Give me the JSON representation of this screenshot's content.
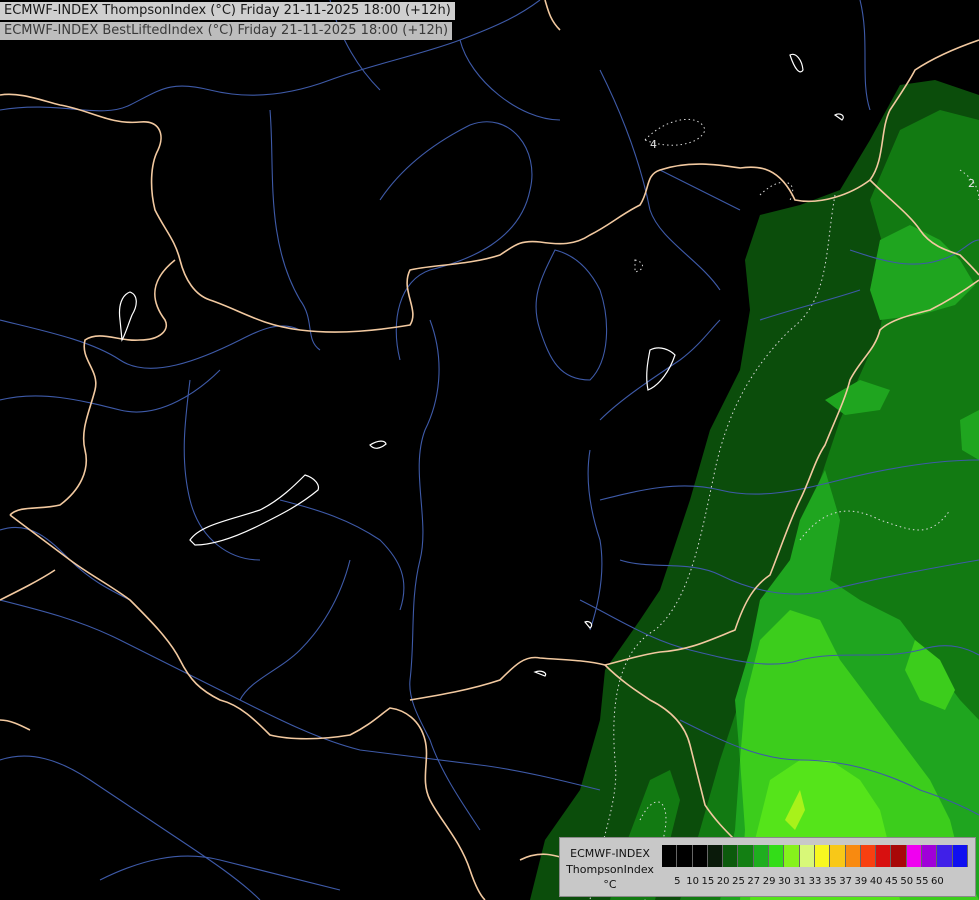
{
  "header": {
    "line1": "ECMWF-INDEX ThompsonIndex (°C) Friday 21-11-2025 18:00 (+12h)",
    "line2": "ECMWF-INDEX BestLiftedIndex (°C) Friday 21-11-2025 18:00 (+12h)"
  },
  "legend": {
    "line1": "ECMWF-INDEX",
    "line2": "ThompsonIndex",
    "line3": "°C",
    "ticks": [
      "5",
      "10",
      "15",
      "20",
      "25",
      "27",
      "29",
      "30",
      "31",
      "33",
      "35",
      "37",
      "39",
      "40",
      "45",
      "50",
      "55",
      "60"
    ],
    "colors": [
      "#000000",
      "#000000",
      "#000000",
      "#0a1a0a",
      "#0c5a0c",
      "#137f13",
      "#1fae1f",
      "#33dd18",
      "#86f21c",
      "#d8f878",
      "#f8f820",
      "#f8c818",
      "#f88a10",
      "#f84010",
      "#d81010",
      "#a80808",
      "#f000f0",
      "#a000d8",
      "#4020e8",
      "#1010f0"
    ]
  },
  "contour_labels": [
    "4",
    "2"
  ],
  "colors": {
    "background": "#000000",
    "border": "#f2c9a0",
    "river": "#3e5aa8",
    "lake_outline": "#ffffff",
    "green_dark": "#0b4d0b",
    "green_mid": "#127a12",
    "green_bright": "#22b422",
    "green_light": "#4fe01c",
    "yellow_green": "#a8f21a"
  }
}
